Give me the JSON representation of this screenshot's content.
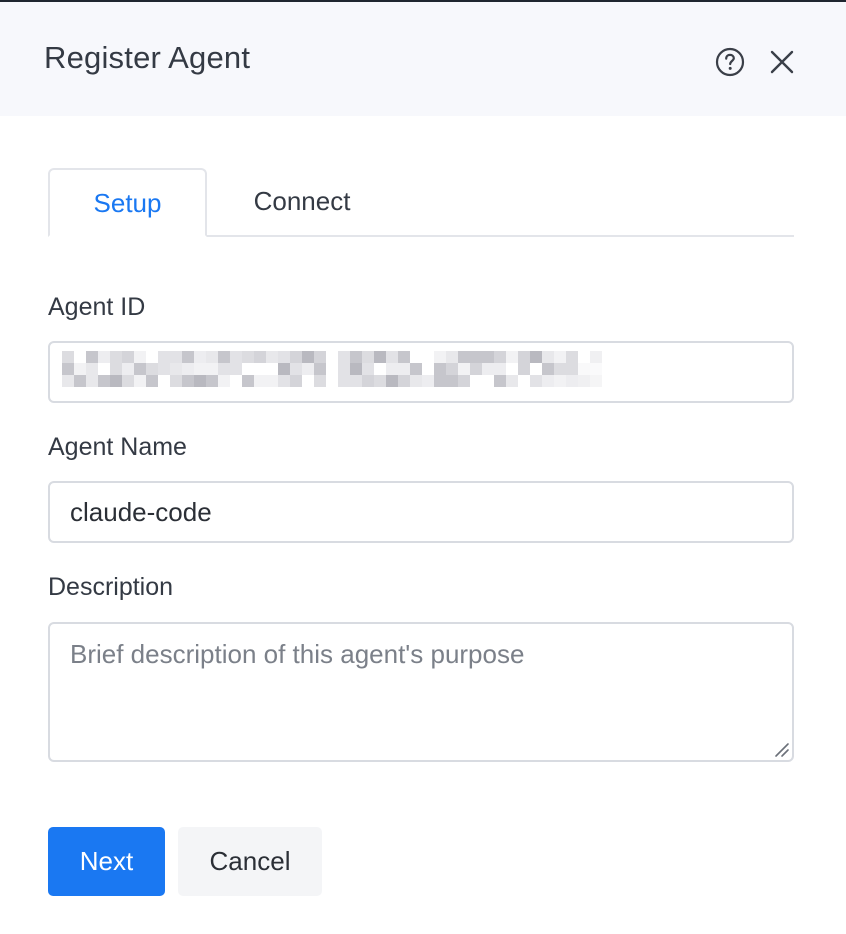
{
  "dialog": {
    "title": "Register Agent",
    "help_icon": "help-circle-icon",
    "close_icon": "close-icon"
  },
  "tabs": [
    {
      "label": "Setup",
      "active": true
    },
    {
      "label": "Connect",
      "active": false
    }
  ],
  "form": {
    "agent_id": {
      "label": "Agent ID",
      "value": "",
      "redacted": true
    },
    "agent_name": {
      "label": "Agent Name",
      "value": "claude-code"
    },
    "description": {
      "label": "Description",
      "value": "",
      "placeholder": "Brief description of this agent's purpose"
    }
  },
  "actions": {
    "next_label": "Next",
    "cancel_label": "Cancel"
  },
  "colors": {
    "accent": "#1a78f2",
    "header_bg": "#f7f8fc",
    "border": "#d8dbe1"
  }
}
